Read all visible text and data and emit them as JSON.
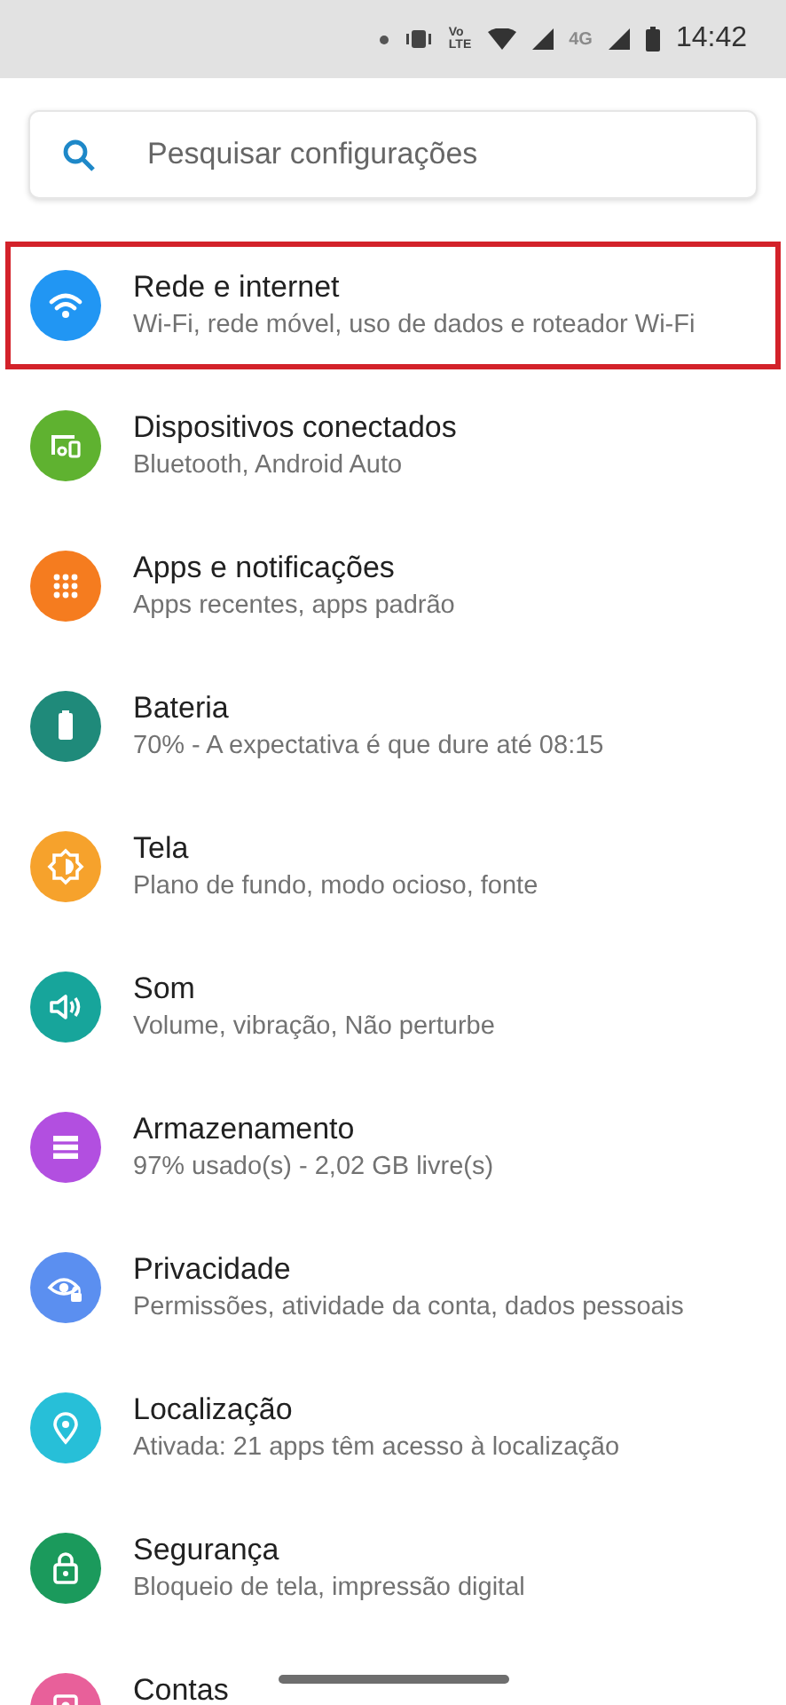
{
  "status_bar": {
    "volte": [
      "Vo",
      "LTE"
    ],
    "network": "4G",
    "time": "14:42"
  },
  "search": {
    "placeholder": "Pesquisar configurações"
  },
  "items": [
    {
      "title": "Rede e internet",
      "subtitle": "Wi-Fi, rede móvel, uso de dados e roteador Wi-Fi",
      "color": "#2196f3",
      "highlighted": true
    },
    {
      "title": "Dispositivos conectados",
      "subtitle": "Bluetooth, Android Auto",
      "color": "#5fb230",
      "highlighted": false
    },
    {
      "title": "Apps e notificações",
      "subtitle": "Apps recentes, apps padrão",
      "color": "#f57c1f",
      "highlighted": false
    },
    {
      "title": "Bateria",
      "subtitle": "70% - A expectativa é que dure até 08:15",
      "color": "#1f8a7a",
      "highlighted": false
    },
    {
      "title": "Tela",
      "subtitle": "Plano de fundo, modo ocioso, fonte",
      "color": "#f6a22c",
      "highlighted": false
    },
    {
      "title": "Som",
      "subtitle": "Volume, vibração, Não perturbe",
      "color": "#17a59b",
      "highlighted": false
    },
    {
      "title": "Armazenamento",
      "subtitle": "97% usado(s) - 2,02 GB livre(s)",
      "color": "#b24fe0",
      "highlighted": false
    },
    {
      "title": "Privacidade",
      "subtitle": "Permissões, atividade da conta, dados pessoais",
      "color": "#5b8ff0",
      "highlighted": false
    },
    {
      "title": "Localização",
      "subtitle": "Ativada: 21 apps têm acesso à localização",
      "color": "#27bfd8",
      "highlighted": false
    },
    {
      "title": "Segurança",
      "subtitle": "Bloqueio de tela, impressão digital",
      "color": "#1b9a5c",
      "highlighted": false
    },
    {
      "title": "Contas",
      "color": "#e8609a",
      "highlighted": false
    }
  ]
}
